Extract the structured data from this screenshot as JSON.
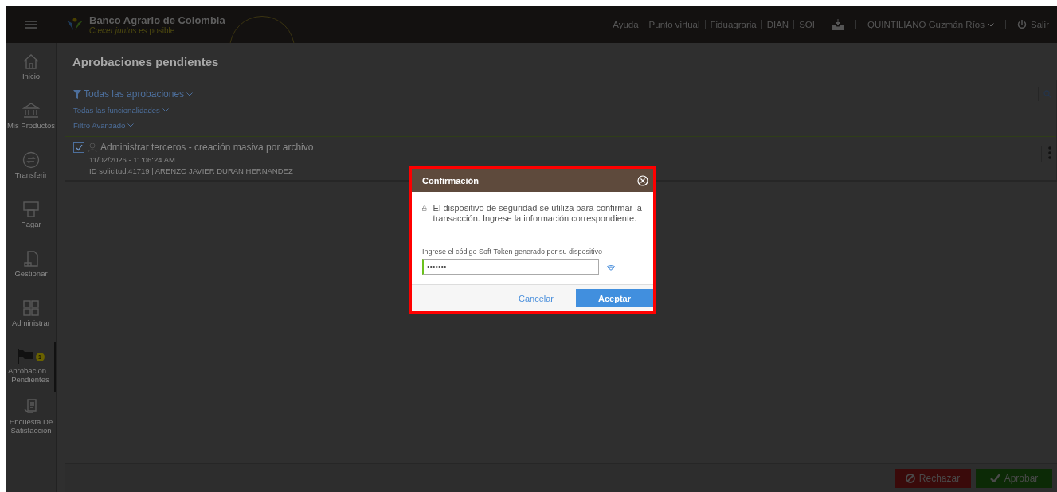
{
  "header": {
    "logo_name": "Banco Agrario de Colombia",
    "logo_slogan": "*Crecer juntos* es posible",
    "links": [
      "Ayuda",
      "Punto virtual",
      "Fiduagraria",
      "DIAN",
      "SOI"
    ],
    "user": "QUINTILIANO Guzmán Ríos",
    "logout": "Salir"
  },
  "sidebar": {
    "items": [
      {
        "kind": "home",
        "label": "Inicio",
        "selected": false
      },
      {
        "kind": "bank",
        "label": "Mis Productos",
        "selected": false
      },
      {
        "kind": "transfer",
        "label": "Transferir",
        "selected": false
      },
      {
        "kind": "pay",
        "label": "Pagar",
        "selected": false
      },
      {
        "kind": "doc",
        "label": "Gestionar",
        "selected": false
      },
      {
        "kind": "grid",
        "label": "Administrar",
        "selected": false
      },
      {
        "kind": "flag",
        "label": "Aprobacion... Pendientes",
        "selected": true,
        "badge": "1"
      },
      {
        "kind": "survey",
        "label": "Encuesta De Satisfacción",
        "selected": false
      }
    ]
  },
  "page_title": "Aprobaciones pendientes",
  "filters": {
    "main": "Todas las aprobaciones",
    "functionality": "Todas las funcionalidades",
    "advanced": "Filtro Avanzado"
  },
  "approvals": [
    {
      "title": "Administrar terceros - creación masiva por archivo",
      "date": "11/02/2026 - 11:06:24 AM",
      "detail": "ID solicitud:41719 | ARENZO JAVIER DURAN HERNANDEZ",
      "checked": true
    }
  ],
  "dialog": {
    "title": "Confirmación",
    "message": "El dispositivo de seguridad se utiliza para confirmar la transacción. Ingrese la información correspondiente.",
    "field_label": "Ingrese el código Soft Token generado por su dispositivo",
    "field_value": "•••••••",
    "buttons": [
      "Cancelar",
      "Aceptar"
    ]
  },
  "actions": [
    "Rechazar",
    "Aprobar"
  ]
}
